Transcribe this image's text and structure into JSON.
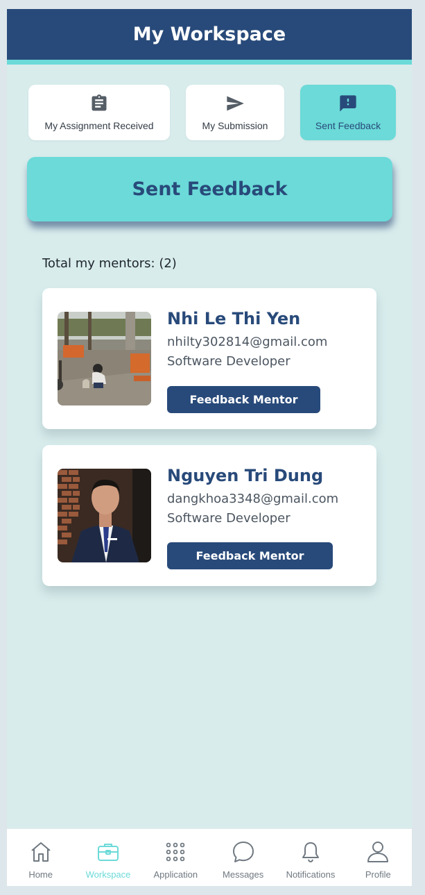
{
  "header": {
    "title": "My Workspace"
  },
  "tabs": [
    {
      "label": "My Assignment Received",
      "icon": "clipboard-icon",
      "active": false
    },
    {
      "label": "My Submission",
      "icon": "send-icon",
      "active": false
    },
    {
      "label": "Sent Feedback",
      "icon": "feedback-icon",
      "active": true
    }
  ],
  "banner": {
    "title": "Sent Feedback"
  },
  "mentors_total": "Total my mentors: (2)",
  "mentors": [
    {
      "name": "Nhi Le Thi Yen",
      "email": "nhilty302814@gmail.com",
      "role": "Software Developer",
      "button_label": "Feedback Mentor"
    },
    {
      "name": "Nguyen Tri Dung",
      "email": "dangkhoa3348@gmail.com",
      "role": "Software Developer",
      "button_label": "Feedback Mentor"
    }
  ],
  "bottom_nav": [
    {
      "label": "Home",
      "icon": "home-icon",
      "active": false
    },
    {
      "label": "Workspace",
      "icon": "briefcase-icon",
      "active": true
    },
    {
      "label": "Application",
      "icon": "grid-icon",
      "active": false
    },
    {
      "label": "Messages",
      "icon": "chat-icon",
      "active": false
    },
    {
      "label": "Notifications",
      "icon": "bell-icon",
      "active": false
    },
    {
      "label": "Profile",
      "icon": "user-icon",
      "active": false
    }
  ],
  "colors": {
    "primary": "#284a7a",
    "accent": "#6bdad8",
    "background": "#d8ecec"
  }
}
